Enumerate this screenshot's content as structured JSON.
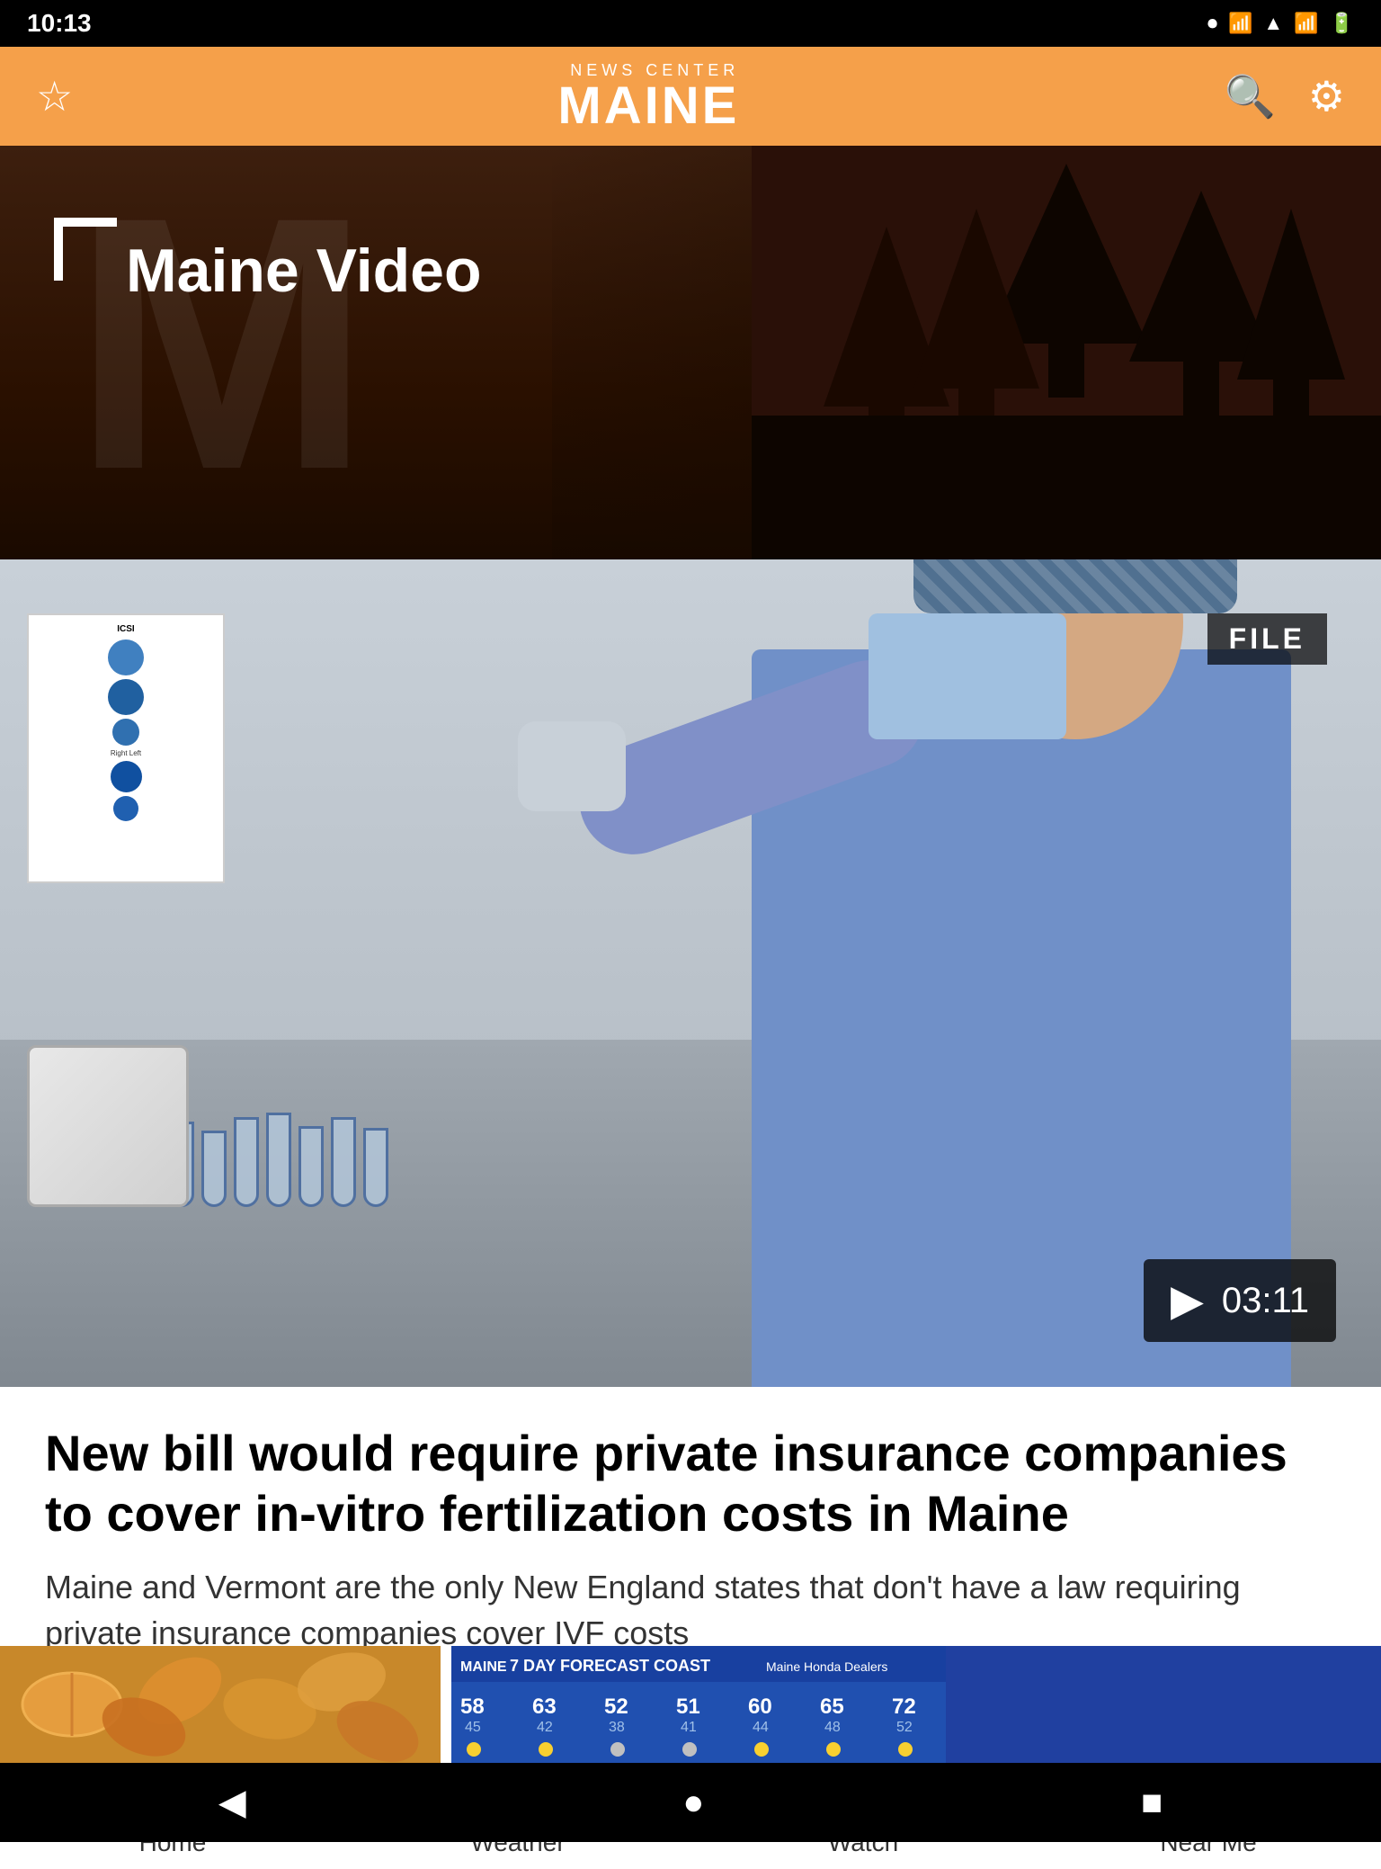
{
  "status": {
    "time": "10:13",
    "icons": [
      "record",
      "sim",
      "wifi",
      "signal",
      "battery"
    ]
  },
  "header": {
    "logo_main": "MAINE",
    "logo_sub": "NEWS CENTER",
    "star_label": "Favorites",
    "search_label": "Search",
    "settings_label": "Settings"
  },
  "hero": {
    "section_label": "Maine Video",
    "bg_letter": "M"
  },
  "video": {
    "file_badge": "FILE",
    "duration": "03:11",
    "play_label": "Play"
  },
  "article": {
    "title": "New bill would require private insurance companies to cover in-vitro fertilization costs in Maine",
    "description": "Maine and Vermont are the only New England states that don't have a law requiring private insurance companies cover IVF costs"
  },
  "bottom_cards": {
    "left_card_label": "thumbnail",
    "right_card": {
      "header": "7 DAY FORECAST COAST",
      "sponsor": "Maine Honda Dealers",
      "temps": [
        "58",
        "63",
        "52",
        "51",
        "60",
        "65",
        "72"
      ]
    }
  },
  "nav": {
    "items": [
      {
        "id": "home",
        "label": "Home",
        "icon": "🏠"
      },
      {
        "id": "weather",
        "label": "Weather",
        "icon": "☀"
      },
      {
        "id": "watch",
        "label": "Watch",
        "icon": "▶"
      },
      {
        "id": "near_me",
        "label": "Near Me",
        "icon": "📍"
      }
    ]
  },
  "android_nav": {
    "back": "◀",
    "home": "●",
    "recents": "■"
  }
}
